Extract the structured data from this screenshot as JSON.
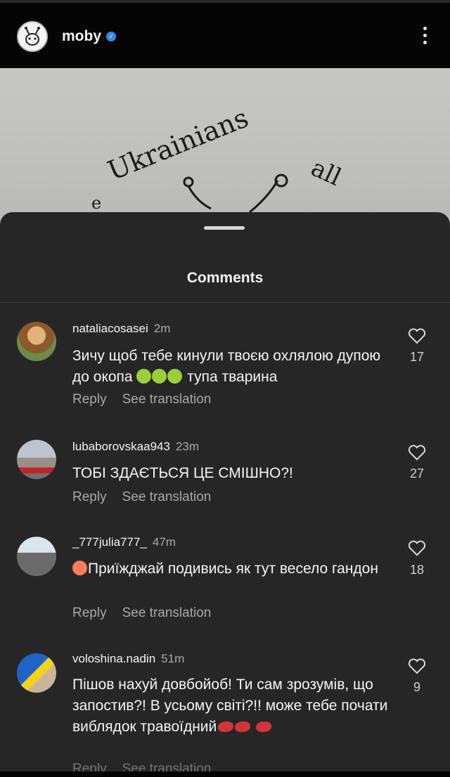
{
  "header": {
    "username": "moby",
    "verified_icon": "verified-badge-icon",
    "more_icon": "more-vertical-icon"
  },
  "post": {
    "handwritten_text_1": "Ukrainians",
    "handwritten_text_2": "all"
  },
  "sheet": {
    "title": "Comments"
  },
  "comments": [
    {
      "username": "nataliacosasei",
      "time": "2m",
      "text_before_emoji": "Зичу щоб тебе кинули твоєю охлялою дупою до окопа ",
      "text_after_emoji": " тупа тварина",
      "reply": "Reply",
      "see_translation": "See translation",
      "likes": "17"
    },
    {
      "username": "lubaborovskaa943",
      "time": "23m",
      "text": "ТОБІ ЗДАЄТЬСЯ ЦЕ СМІШНО?!",
      "reply": "Reply",
      "see_translation": "See translation",
      "likes": "27"
    },
    {
      "username": "_777julia777_",
      "time": "47m",
      "text": "Приїжджай подивись як тут весело гандон",
      "reply": "Reply",
      "see_translation": "See translation",
      "likes": "18"
    },
    {
      "username": "voloshina.nadin",
      "time": "51m",
      "text": "Пішов нахуй довбойоб! Ти сам зрозумів, що запостив?! В усьому світі?!! може тебе почати виблядок травоїдний",
      "reply": "Reply",
      "see_translation": "See translation",
      "likes": "9"
    }
  ],
  "colors": {
    "background": "#000000",
    "sheet": "#262626",
    "secondary_text": "#a8a8a8",
    "verified": "#2e8de6"
  }
}
